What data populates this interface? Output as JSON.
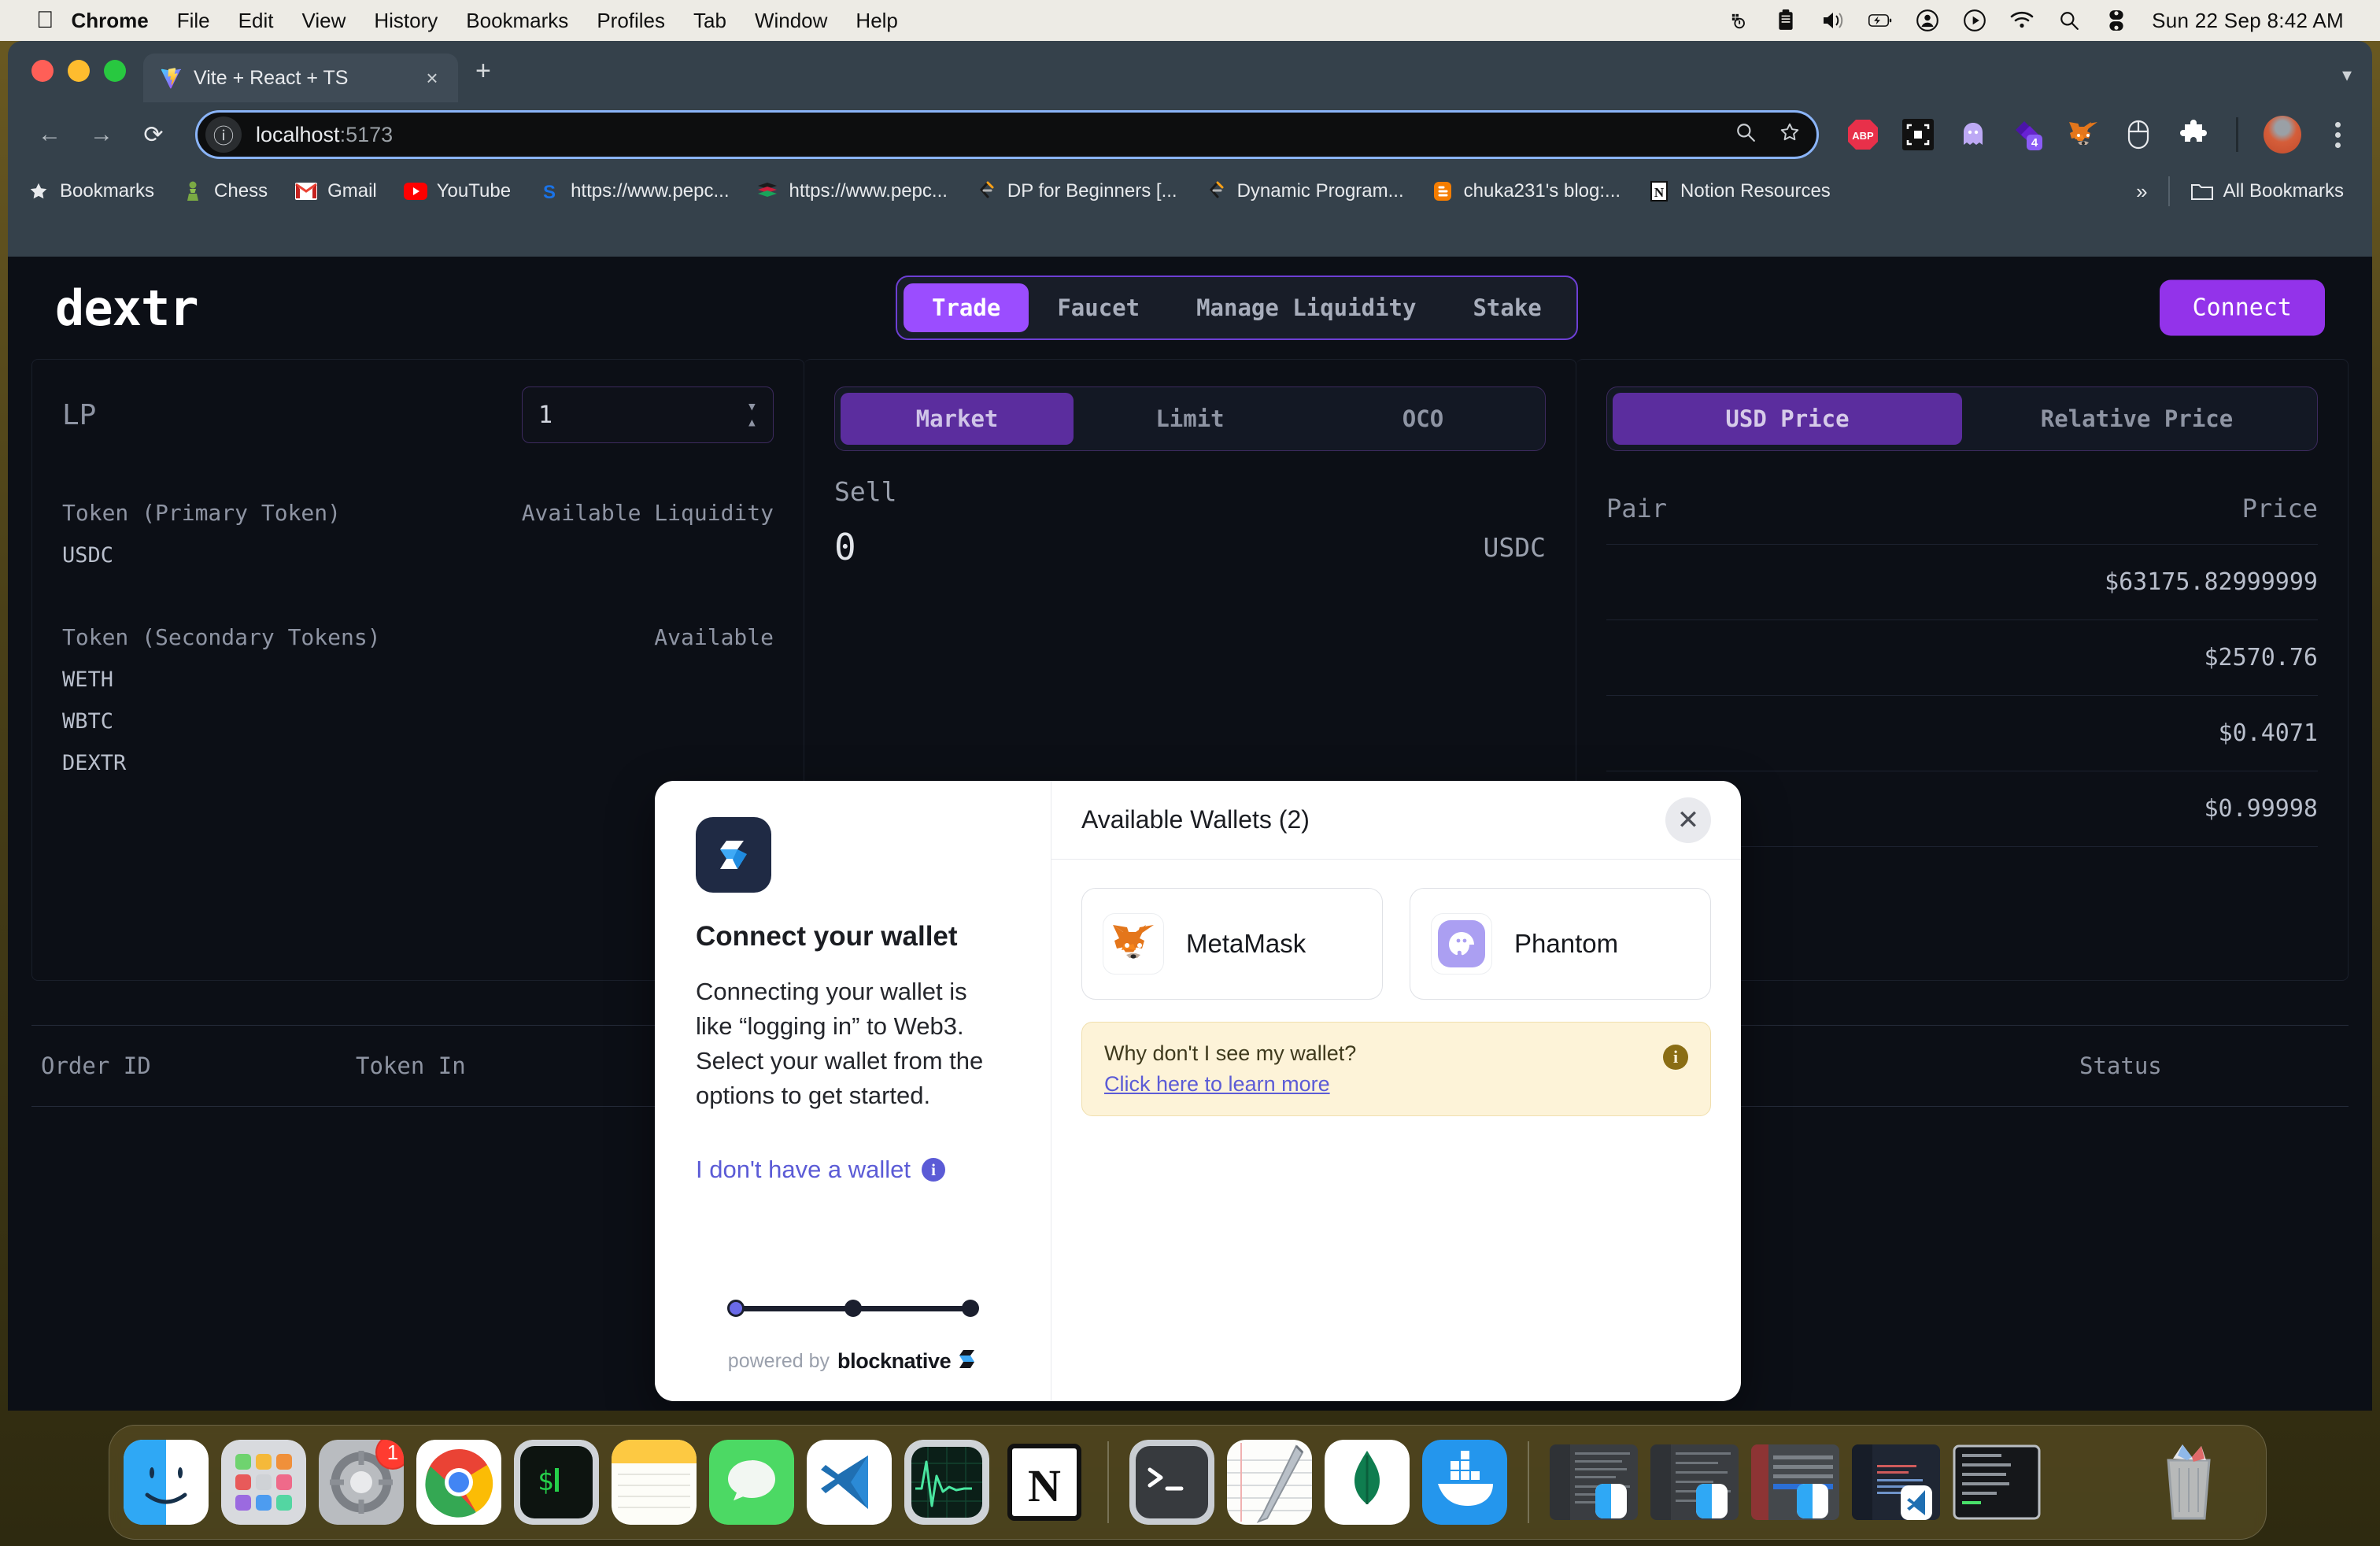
{
  "menubar": {
    "apple_icon": "apple-logo",
    "items": [
      {
        "label": "Chrome",
        "bold": true
      },
      {
        "label": "File",
        "bold": false
      },
      {
        "label": "Edit",
        "bold": false
      },
      {
        "label": "View",
        "bold": false
      },
      {
        "label": "History",
        "bold": false
      },
      {
        "label": "Bookmarks",
        "bold": false
      },
      {
        "label": "Profiles",
        "bold": false
      },
      {
        "label": "Tab",
        "bold": false
      },
      {
        "label": "Window",
        "bold": false
      },
      {
        "label": "Help",
        "bold": false
      }
    ],
    "status_icons": [
      "docker-icon",
      "clipboard-icon",
      "volume-icon",
      "battery-charging-icon",
      "user-circle-icon",
      "play-circle-icon",
      "wifi-icon",
      "search-icon",
      "control-center-icon"
    ],
    "clock": "Sun 22 Sep  8:42 AM"
  },
  "browser": {
    "tab": {
      "title": "Vite + React + TS",
      "favicon": "vite-logo-icon",
      "close": "×"
    },
    "new_tab_label": "+",
    "tabstrip_right_icon": "chevron-down-icon",
    "nav": {
      "back": "←",
      "forward": "→",
      "reload": "⟳"
    },
    "omnibox": {
      "site_info_icon": "info-circle-icon",
      "url_host": "localhost",
      "url_port": ":5173",
      "zoom_icon": "search-icon",
      "bookmark_icon": "star-icon"
    },
    "extensions": [
      {
        "name": "adblock-plus-icon",
        "label": "ABP"
      },
      {
        "name": "qr-scanner-icon",
        "label": ""
      },
      {
        "name": "ghostery-icon",
        "label": ""
      },
      {
        "name": "phantom-wallet-icon",
        "label": "4"
      },
      {
        "name": "metamask-icon",
        "label": ""
      },
      {
        "name": "mouse-icon",
        "label": ""
      },
      {
        "name": "extensions-puzzle-icon",
        "label": ""
      }
    ],
    "profile_icon": "profile-avatar",
    "menu_icon": "kebab-menu-icon",
    "bookmarks": [
      {
        "label": "Bookmarks",
        "icon": "star-icon"
      },
      {
        "label": "Chess",
        "icon": "chess-pawn-icon"
      },
      {
        "label": "Gmail",
        "icon": "gmail-icon"
      },
      {
        "label": "YouTube",
        "icon": "youtube-icon"
      },
      {
        "label": "https://www.pepc...",
        "icon": "s-blue-icon"
      },
      {
        "label": "https://www.pepc...",
        "icon": "red-books-icon"
      },
      {
        "label": "DP for Beginners [...",
        "icon": "leetcode-icon"
      },
      {
        "label": "Dynamic Program...",
        "icon": "leetcode-icon"
      },
      {
        "label": "chuka231's blog:...",
        "icon": "blogger-icon"
      },
      {
        "label": "Notion Resources",
        "icon": "notion-icon"
      }
    ],
    "bookmarks_overflow": "»",
    "all_bookmarks_label": "All Bookmarks",
    "all_bookmarks_icon": "folder-icon"
  },
  "app": {
    "logo": "dextr",
    "nav_tabs": [
      {
        "label": "Trade",
        "active": true
      },
      {
        "label": "Faucet",
        "active": false
      },
      {
        "label": "Manage Liquidity",
        "active": false
      },
      {
        "label": "Stake",
        "active": false
      }
    ],
    "connect_button": "Connect",
    "lp_panel": {
      "title": "LP",
      "select_value": "1",
      "stepper_icon": "stepper-updown-icon",
      "primary_col_label": "Token (Primary Token)",
      "primary_liquidity_label": "Available Liquidity",
      "primary_rows": [
        {
          "token": "USDC",
          "liquidity": ""
        }
      ],
      "secondary_col_label": "Token (Secondary Tokens)",
      "secondary_liquidity_label": "Available",
      "secondary_rows": [
        {
          "token": "WETH",
          "liquidity": ""
        },
        {
          "token": "WBTC",
          "liquidity": ""
        },
        {
          "token": "DEXTR",
          "liquidity": ""
        }
      ]
    },
    "trade_panel": {
      "order_types": [
        {
          "label": "Market",
          "active": true
        },
        {
          "label": "Limit",
          "active": false
        },
        {
          "label": "OCO",
          "active": false
        }
      ],
      "side_label": "Sell",
      "amount": "0",
      "amount_token": "USDC"
    },
    "price_panel": {
      "modes": [
        {
          "label": "USD Price",
          "active": true
        },
        {
          "label": "Relative Price",
          "active": false
        }
      ],
      "col_pair": "Pair",
      "col_price": "Price",
      "rows": [
        {
          "pair": "",
          "price": "$63175.82999999"
        },
        {
          "pair": "",
          "price": "$2570.76"
        },
        {
          "pair": "",
          "price": "$0.4071"
        },
        {
          "pair": "",
          "price": "$0.99998"
        }
      ]
    },
    "orders_table": {
      "headers": [
        "Order ID",
        "Token In",
        "",
        "Status"
      ]
    }
  },
  "modal": {
    "logo_icon": "blocknative-logo-icon",
    "heading": "Connect your wallet",
    "body": "Connecting your wallet is like “logging in” to Web3. Select your wallet from the options to get started.",
    "no_wallet_link": "I don't have a wallet",
    "no_wallet_info_icon": "info-icon",
    "powered_prefix": "powered by",
    "powered_brand": "blocknative",
    "progress_dots": 3,
    "progress_active_index": 0,
    "right": {
      "title": "Available Wallets (2)",
      "close_icon": "close-icon",
      "wallets": [
        {
          "name": "MetaMask",
          "icon": "metamask-fox-icon"
        },
        {
          "name": "Phantom",
          "icon": "phantom-ghost-icon"
        }
      ],
      "warning": {
        "question": "Why don't I see my wallet?",
        "link": "Click here to learn more",
        "icon": "info-icon",
        "bg_color": "#fdf3d8",
        "link_color": "#5b5bd6"
      }
    }
  },
  "dock": {
    "items": [
      {
        "name": "finder",
        "running": true,
        "badge": ""
      },
      {
        "name": "launchpad",
        "running": false,
        "badge": ""
      },
      {
        "name": "system-settings",
        "running": false,
        "badge": "1"
      },
      {
        "name": "google-chrome",
        "running": true,
        "badge": ""
      },
      {
        "name": "iterm2",
        "running": true,
        "badge": ""
      },
      {
        "name": "notes",
        "running": false,
        "badge": ""
      },
      {
        "name": "messages",
        "running": false,
        "badge": ""
      },
      {
        "name": "visual-studio-code",
        "running": true,
        "badge": ""
      },
      {
        "name": "activity-monitor",
        "running": false,
        "badge": ""
      },
      {
        "name": "notion",
        "running": false,
        "badge": ""
      }
    ],
    "items2": [
      {
        "name": "terminal",
        "running": true,
        "badge": ""
      },
      {
        "name": "textedit",
        "running": true,
        "badge": ""
      },
      {
        "name": "mongodb-compass",
        "running": true,
        "badge": ""
      },
      {
        "name": "docker",
        "running": true,
        "badge": ""
      }
    ],
    "minimized": [
      {
        "name": "finder-window-minimized"
      },
      {
        "name": "finder-window-minimized"
      },
      {
        "name": "finder-window-minimized"
      },
      {
        "name": "vscode-window-minimized"
      },
      {
        "name": "terminal-window-minimized"
      }
    ],
    "trash": {
      "name": "trash-full-icon"
    }
  },
  "colors": {
    "accent_purple": "#9b4dff",
    "app_bg": "#0c0f16",
    "chrome_bg": "#35414b",
    "modal_bg": "#ffffff",
    "warning_bg": "#fdf3d8",
    "link": "#5b5bd6"
  }
}
